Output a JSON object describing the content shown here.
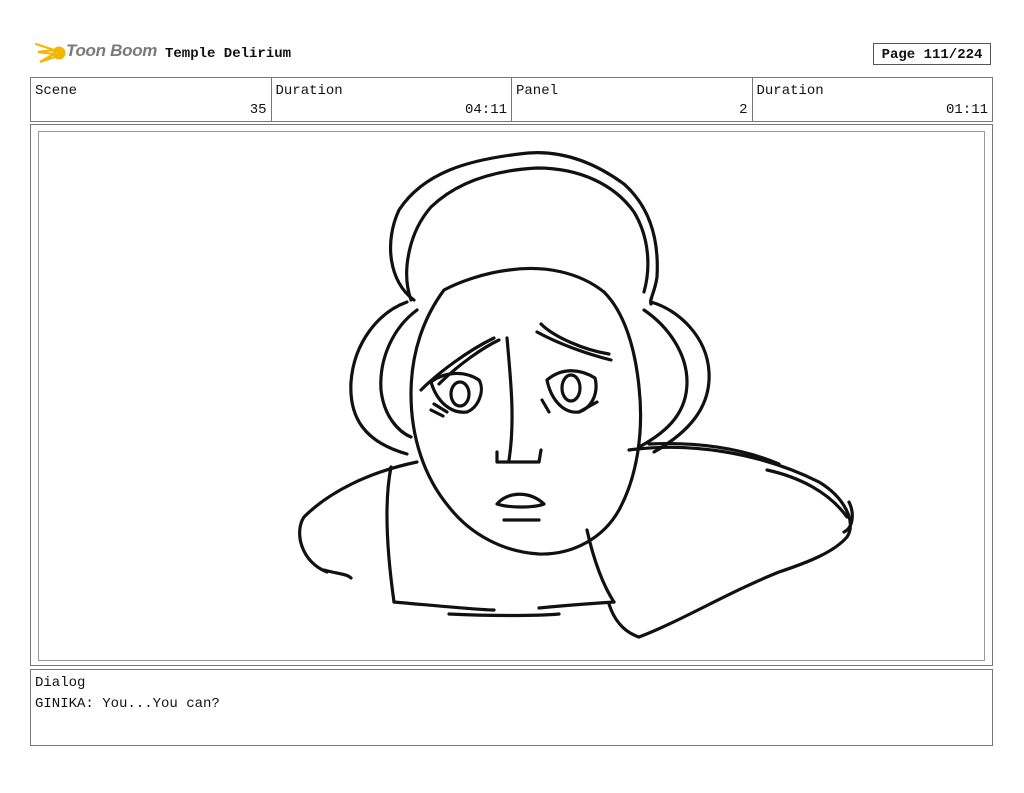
{
  "header": {
    "logo_text": "Toon Boom",
    "project_title": "Temple Delirium",
    "page_label": "Page 111/224"
  },
  "info": {
    "scene_label": "Scene",
    "scene_value": "35",
    "scene_duration_label": "Duration",
    "scene_duration_value": "04:11",
    "panel_label": "Panel",
    "panel_value": "2",
    "panel_duration_label": "Duration",
    "panel_duration_value": "01:11"
  },
  "dialog": {
    "label": "Dialog",
    "text": "GINIKA: You...You can?"
  },
  "colors": {
    "logo_accent": "#f2b705",
    "logo_text": "#7a7a7a"
  }
}
